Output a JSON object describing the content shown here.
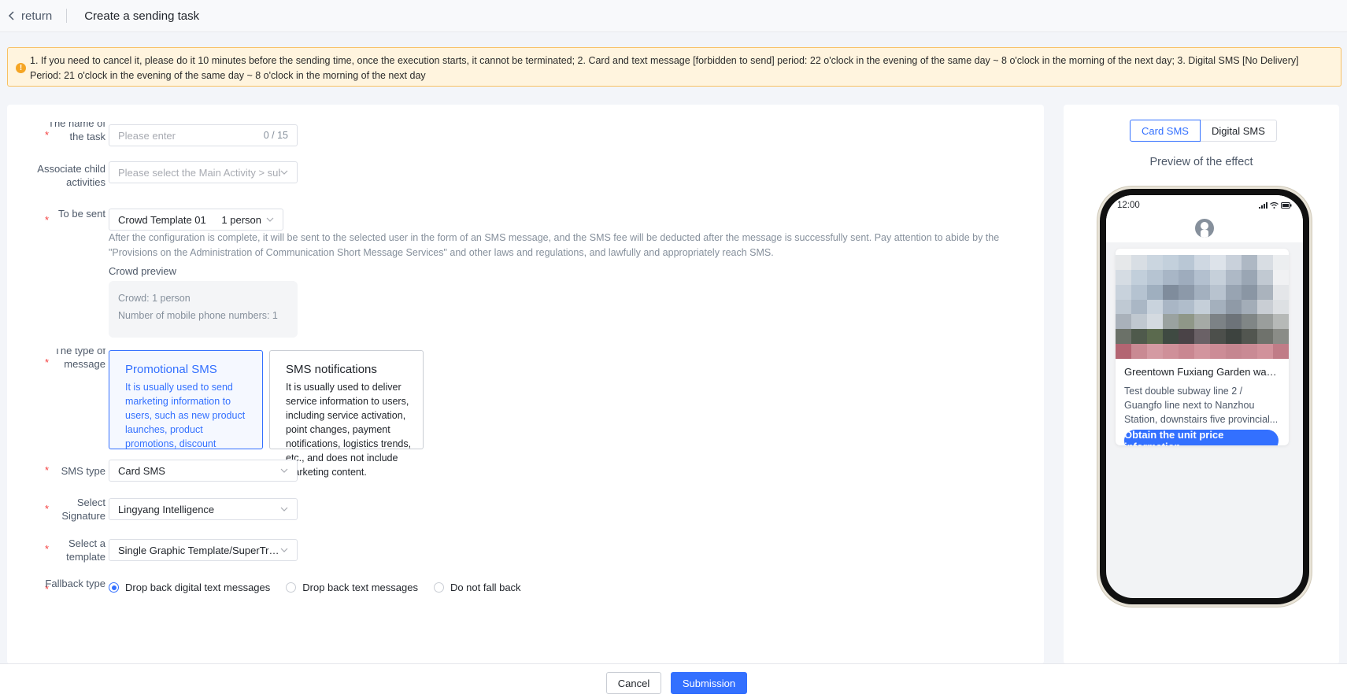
{
  "header": {
    "back_label": "return",
    "title": "Create a sending task"
  },
  "notice": {
    "text": "1. If you need to cancel it, please do it 10 minutes before the sending time, once the execution starts, it cannot be terminated; 2. Card and text message [forbidden to send] period: 22 o'clock in the evening of the same day ~ 8 o'clock in the morning of the next day; 3. Digital SMS [No Delivery] Period: 21 o'clock in the evening of the same day ~ 8 o'clock in the morning of the next day",
    "icon": "warning-icon",
    "color": "#f5a524"
  },
  "form": {
    "name": {
      "label": "The name of the task",
      "placeholder": "Please enter",
      "counter": "0 / 15"
    },
    "child_activity": {
      "label": "Associate child activities",
      "placeholder": "Please select the Main Activity > subactivity"
    },
    "recipients": {
      "label": "To be sent",
      "value": "Crowd Template 01",
      "count": "1 person",
      "hint": "After the configuration is complete, it will be sent to the selected user in the form of an SMS message, and the SMS fee will be deducted after the message is successfully sent. Pay attention to abide by the \"Provisions on the Administration of Communication Short Message Services\" and other laws and regulations, and lawfully and appropriately reach SMS.",
      "preview_title": "Crowd preview",
      "preview_crowd": "Crowd: 1 person",
      "preview_numbers": "Number of mobile phone numbers: 1"
    },
    "message_type": {
      "label": "The type of message",
      "options": [
        {
          "title": "Promotional SMS",
          "desc": "It is usually used to send marketing information to users, such as new product launches, product promotions, discount coupons, event invitations, etc.",
          "selected": true
        },
        {
          "title": "SMS notifications",
          "desc": "It is usually used to deliver service information to users, including service activation, point changes, payment notifications, logistics trends, etc., and does not include marketing content.",
          "selected": false
        }
      ]
    },
    "sms_type": {
      "label": "SMS type",
      "value": "Card SMS"
    },
    "signature": {
      "label": "Select Signature",
      "value": "Lingyang Intelligence"
    },
    "template": {
      "label": "Select a template",
      "value": "Single Graphic Template/SuperTransport"
    },
    "fallback": {
      "label": "Fallback type",
      "options": [
        {
          "label": "Drop back digital text messages",
          "checked": true
        },
        {
          "label": "Drop back text messages",
          "checked": false
        },
        {
          "label": "Do not fall back",
          "checked": false
        }
      ]
    }
  },
  "footer": {
    "cancel_label": "Cancel",
    "submit_label": "Submission"
  },
  "preview": {
    "tabs": [
      {
        "label": "Card SMS",
        "active": true
      },
      {
        "label": "Digital SMS",
        "active": false
      }
    ],
    "title": "Preview of the effect",
    "phone_time": "12:00",
    "card_title": "Greentown Fuxiang Garden was ...",
    "card_desc": "Test double subway line 2 / Guangfo line next to Nanzhou Station, downstairs five provincial...",
    "card_button": "Obtain the unit price information"
  },
  "colors": {
    "primary": "#3370ff",
    "required": "#f53f3f",
    "notice_bg": "#fff4de",
    "notice_border": "#f8c063"
  }
}
